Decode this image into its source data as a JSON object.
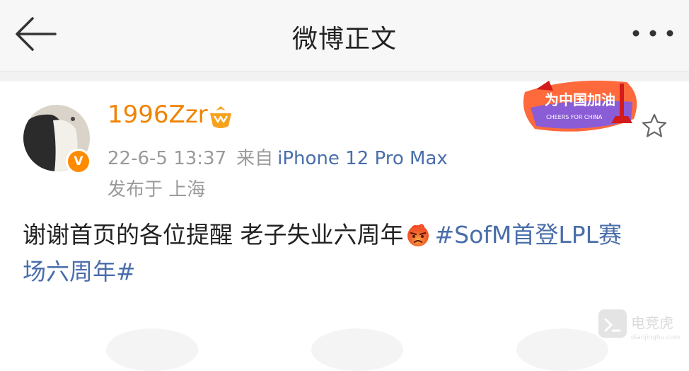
{
  "header": {
    "title": "微博正文"
  },
  "post": {
    "username": "1996Zzr",
    "avatar_badge": "V",
    "time": "22-6-5 13:37",
    "source_prefix": "来自",
    "device": "iPhone 12 Pro Max",
    "location": "发布于 上海",
    "text": "谢谢首页的各位提醒 老子失业六周年",
    "hashtag_line1": "#SofM首登LPL赛",
    "hashtag_line2": "场六周年#"
  },
  "event_badge": {
    "title": "为中国加油",
    "subtitle": "CHEERS FOR CHINA"
  },
  "watermark": {
    "name": "电竞虎",
    "url": "dianjinghu.com"
  },
  "colors": {
    "username": "#f08300",
    "link": "#4a6eab",
    "meta": "#9a9a9a"
  },
  "icons": [
    "back-arrow-icon",
    "more-icon",
    "vip-icon",
    "star-icon",
    "angry-emoji-icon"
  ]
}
